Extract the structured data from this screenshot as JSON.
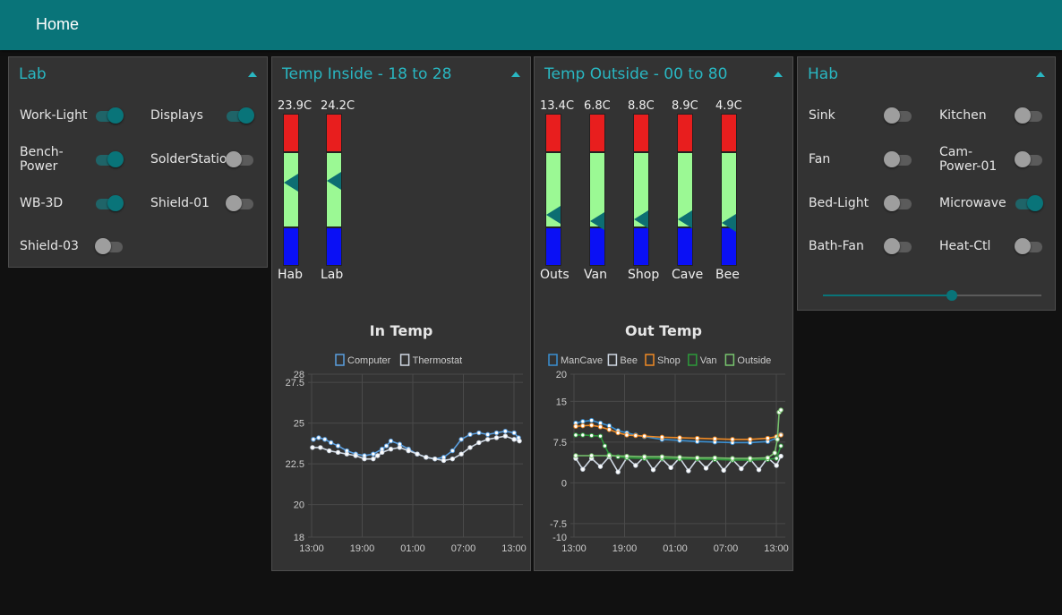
{
  "header": {
    "title": "Home"
  },
  "lab": {
    "title": "Lab",
    "switches": [
      {
        "label": "Work-Light",
        "on": true
      },
      {
        "label": "Displays",
        "on": true
      },
      {
        "label": "Bench-Power",
        "label_lines": [
          "Bench-",
          "Power"
        ],
        "on": true
      },
      {
        "label": "SolderStation",
        "on": false
      },
      {
        "label": "WB-3D",
        "on": true
      },
      {
        "label": "Shield-01",
        "on": false
      },
      {
        "label": "Shield-03",
        "on": false
      }
    ]
  },
  "temp_inside": {
    "title": "Temp Inside - 18 to 28",
    "gauges": [
      {
        "label": "Hab",
        "value_text": "23.9C",
        "value": 23.9
      },
      {
        "label": "Lab",
        "value_text": "24.2C",
        "value": 24.2
      }
    ],
    "chart": {
      "title": "In Temp"
    }
  },
  "temp_outside": {
    "title": "Temp Outside - 00 to 80",
    "gauges": [
      {
        "label": "Outs",
        "value_text": "13.4C",
        "value": 13.4
      },
      {
        "label": "Van",
        "value_text": "6.8C",
        "value": 6.8
      },
      {
        "label": "Shop",
        "value_text": "8.8C",
        "value": 8.8
      },
      {
        "label": "Cave",
        "value_text": "8.9C",
        "value": 8.9
      },
      {
        "label": "Bee",
        "value_text": "4.9C",
        "value": 4.9
      }
    ],
    "chart": {
      "title": "Out Temp"
    }
  },
  "hab": {
    "title": "Hab",
    "switches": [
      {
        "label": "Sink",
        "on": false
      },
      {
        "label": "Kitchen",
        "on": false
      },
      {
        "label": "Fan",
        "on": false
      },
      {
        "label": "Cam-Power-01",
        "label_lines": [
          "Cam-",
          "Power-01"
        ],
        "on": false
      },
      {
        "label": "Bed-Light",
        "on": false
      },
      {
        "label": "Microwave",
        "on": true
      },
      {
        "label": "Bath-Fan",
        "on": false
      },
      {
        "label": "Heat-Ctl",
        "on": false
      }
    ],
    "slider": {
      "value": 0.59
    }
  },
  "colors": {
    "accent": "#097479",
    "title": "#29b7c2",
    "gauge_high": "#e81e1e",
    "gauge_mid": "#9bf994",
    "gauge_low": "#0a10f5",
    "pointer": "#0d6e72"
  },
  "chart_data": [
    {
      "type": "line",
      "title": "In Temp",
      "x_ticks": [
        "13:00",
        "19:00",
        "01:00",
        "07:00",
        "13:00"
      ],
      "y_ticks": [
        18,
        20,
        22.5,
        25,
        27.5,
        28
      ],
      "ylim": [
        18,
        28
      ],
      "legend_position": "top",
      "grid": true,
      "series": [
        {
          "name": "Computer",
          "color": "#5a9fe0",
          "x": [
            0.2,
            0.8,
            1.5,
            2.2,
            3.0,
            4.0,
            5.0,
            6.0,
            7.0,
            8.0,
            8.5,
            9.0,
            10.0,
            11.0,
            12.0,
            13.0,
            14.0,
            15.0,
            16.0,
            17.0,
            18.0,
            19.0,
            20.0,
            21.0,
            22.0,
            23.0,
            23.5
          ],
          "y": [
            24.0,
            24.1,
            24.0,
            23.8,
            23.6,
            23.3,
            23.1,
            23.0,
            23.1,
            23.4,
            23.6,
            23.9,
            23.7,
            23.4,
            23.1,
            22.9,
            22.8,
            22.9,
            23.3,
            24.0,
            24.3,
            24.4,
            24.3,
            24.4,
            24.5,
            24.4,
            24.1
          ]
        },
        {
          "name": "Thermostat",
          "color": "#cfd8e3",
          "x": [
            0.1,
            1.0,
            2.0,
            3.0,
            4.0,
            5.0,
            6.0,
            7.0,
            7.5,
            8.0,
            9.0,
            10.0,
            11.0,
            12.0,
            13.0,
            14.0,
            15.0,
            16.0,
            17.0,
            18.0,
            19.0,
            20.0,
            21.0,
            22.0,
            23.0,
            23.6
          ],
          "y": [
            23.5,
            23.5,
            23.3,
            23.2,
            23.1,
            23.0,
            22.8,
            22.8,
            23.0,
            23.2,
            23.4,
            23.5,
            23.3,
            23.1,
            22.9,
            22.8,
            22.7,
            22.8,
            23.1,
            23.5,
            23.8,
            24.0,
            24.1,
            24.2,
            24.0,
            23.9
          ]
        }
      ]
    },
    {
      "type": "line",
      "title": "Out Temp",
      "x_ticks": [
        "13:00",
        "19:00",
        "01:00",
        "07:00",
        "13:00"
      ],
      "y_ticks": [
        20,
        15,
        7.5,
        0,
        -7.5,
        -10
      ],
      "ylim": [
        -10,
        20
      ],
      "legend_position": "top",
      "grid": true,
      "series": [
        {
          "name": "ManCave",
          "color": "#3a8fd1",
          "x": [
            0.2,
            1.0,
            2.0,
            3.0,
            4.0,
            5.0,
            6.0,
            7.0,
            8.0,
            10.0,
            12.0,
            14.0,
            16.0,
            18.0,
            20.0,
            22.0,
            23.0,
            23.5
          ],
          "y": [
            11.0,
            11.3,
            11.5,
            11.0,
            10.5,
            9.6,
            9.2,
            8.8,
            8.5,
            8.0,
            7.8,
            7.6,
            7.5,
            7.4,
            7.4,
            7.6,
            8.2,
            8.9
          ]
        },
        {
          "name": "Bee",
          "color": "#cfd8e3",
          "x": [
            0.2,
            1.0,
            2.0,
            3.0,
            4.0,
            5.0,
            6.0,
            7.0,
            8.0,
            9.0,
            10.0,
            11.0,
            12.0,
            13.0,
            14.0,
            15.0,
            16.0,
            17.0,
            18.0,
            19.0,
            20.0,
            21.0,
            22.0,
            23.0,
            23.5
          ],
          "y": [
            4.5,
            2.5,
            4.5,
            3.0,
            4.8,
            2.0,
            4.6,
            3.2,
            4.8,
            2.4,
            4.4,
            2.8,
            4.6,
            2.2,
            4.4,
            2.7,
            4.5,
            2.3,
            4.3,
            2.6,
            4.4,
            2.4,
            4.6,
            3.2,
            4.9
          ]
        },
        {
          "name": "Shop",
          "color": "#f08a24",
          "x": [
            0.2,
            1.0,
            2.0,
            3.0,
            4.0,
            5.0,
            6.0,
            7.0,
            8.0,
            10.0,
            12.0,
            14.0,
            16.0,
            18.0,
            20.0,
            22.0,
            23.0,
            23.5
          ],
          "y": [
            10.4,
            10.5,
            10.6,
            10.3,
            9.8,
            9.2,
            8.8,
            8.7,
            8.6,
            8.4,
            8.3,
            8.2,
            8.1,
            8.0,
            8.0,
            8.2,
            8.5,
            8.8
          ]
        },
        {
          "name": "Van",
          "color": "#2c9a3a",
          "x": [
            0.2,
            1.0,
            2.0,
            3.0,
            3.5,
            4.0,
            5.0,
            6.0,
            8.0,
            10.0,
            12.0,
            14.0,
            16.0,
            18.0,
            20.0,
            22.0,
            23.0,
            23.5
          ],
          "y": [
            8.8,
            8.8,
            8.7,
            8.6,
            6.8,
            5.2,
            4.8,
            4.6,
            4.5,
            4.5,
            4.4,
            4.4,
            4.3,
            4.2,
            4.2,
            4.3,
            4.5,
            6.8
          ]
        },
        {
          "name": "Outside",
          "color": "#78c46e",
          "x": [
            0.2,
            2.0,
            4.0,
            6.0,
            8.0,
            10.0,
            12.0,
            14.0,
            16.0,
            18.0,
            20.0,
            22.0,
            22.8,
            23.1,
            23.3,
            23.5
          ],
          "y": [
            5.0,
            5.0,
            5.0,
            4.9,
            4.8,
            4.8,
            4.7,
            4.6,
            4.6,
            4.5,
            4.5,
            4.6,
            5.5,
            8.0,
            13.0,
            13.4
          ]
        }
      ]
    }
  ]
}
